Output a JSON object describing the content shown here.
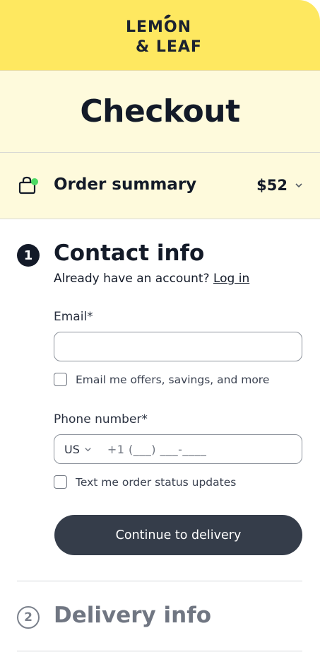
{
  "brand": {
    "logo_line1": "LEMON",
    "logo_line2": "& LEAF"
  },
  "header": {
    "title": "Checkout"
  },
  "order_summary": {
    "label": "Order summary",
    "total": "$52",
    "icon": "shopping-bag-icon",
    "dot_color": "#4cd964"
  },
  "contact": {
    "step_number": "1",
    "title": "Contact info",
    "account_prompt": "Already have an account?",
    "login_label": "Log in",
    "email_label": "Email*",
    "email_value": "",
    "email_opt_in_label": "Email me offers, savings, and more",
    "phone_label": "Phone number*",
    "country_code": "US",
    "phone_placeholder": "+1 (___) ___-____",
    "sms_opt_in_label": "Text me order status updates",
    "continue_label": "Continue to delivery"
  },
  "delivery": {
    "step_number": "2",
    "title": "Delivery info"
  },
  "colors": {
    "brand_yellow": "#fee860",
    "band_cream": "#fefadc",
    "button_dark": "#353d4a",
    "text_dark": "#131a28",
    "muted": "#707682"
  }
}
